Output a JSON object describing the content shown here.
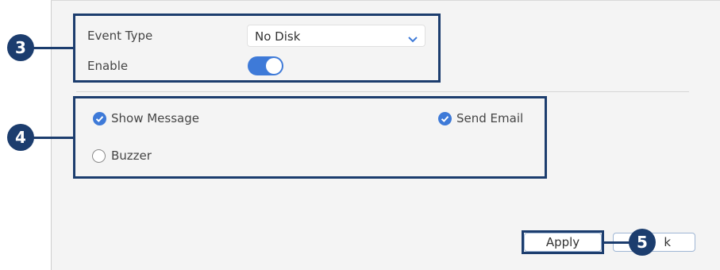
{
  "form": {
    "event_type_label": "Event Type",
    "event_type_value": "No Disk",
    "enable_label": "Enable",
    "enable_on": true
  },
  "actions": {
    "show_message_label": "Show Message",
    "show_message_checked": true,
    "send_email_label": "Send Email",
    "send_email_checked": true,
    "buzzer_label": "Buzzer",
    "buzzer_checked": false
  },
  "buttons": {
    "apply_label": "Apply",
    "back_label_visible": "k"
  },
  "callouts": [
    "3",
    "4",
    "5"
  ],
  "colors": {
    "accent": "#3e7ad8",
    "callout": "#1c3d6e"
  },
  "icons": {
    "dropdown": "chevron-down-icon",
    "checked": "check-circle-icon",
    "unchecked": "radio-empty-icon"
  }
}
